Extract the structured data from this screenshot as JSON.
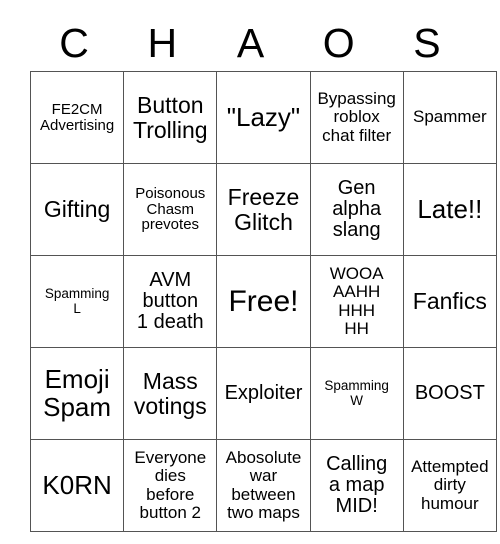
{
  "card": {
    "title_letters": [
      "C",
      "H",
      "A",
      "O",
      "S"
    ],
    "rows": [
      [
        {
          "text": "FE2CM\nAdvertising",
          "size": "fs-xxs"
        },
        {
          "text": "Button\nTrolling",
          "size": "fs-md"
        },
        {
          "text": "\"Lazy\"",
          "size": "fs-lg"
        },
        {
          "text": "Bypassing\nroblox\nchat filter",
          "size": "fs-xs"
        },
        {
          "text": "Spammer",
          "size": "fs-xs"
        }
      ],
      [
        {
          "text": "Gifting",
          "size": "fs-md"
        },
        {
          "text": "Poisonous\nChasm\nprevotes",
          "size": "fs-xxs"
        },
        {
          "text": "Freeze\nGlitch",
          "size": "fs-md"
        },
        {
          "text": "Gen\nalpha\nslang",
          "size": "fs-sm"
        },
        {
          "text": "Late!!",
          "size": "fs-lg"
        }
      ],
      [
        {
          "text": "Spamming\nL",
          "size": "fs-tiny"
        },
        {
          "text": "AVM\nbutton\n1 death",
          "size": "fs-sm"
        },
        {
          "text": "Free!",
          "size": "fs-xl"
        },
        {
          "text": "WOOA\nAAHH\nHHH\nHH",
          "size": "fs-xs"
        },
        {
          "text": "Fanfics",
          "size": "fs-md"
        }
      ],
      [
        {
          "text": "Emoji\nSpam",
          "size": "fs-lg"
        },
        {
          "text": "Mass\nvotings",
          "size": "fs-md"
        },
        {
          "text": "Exploiter",
          "size": "fs-sm"
        },
        {
          "text": "Spamming\nW",
          "size": "fs-tiny"
        },
        {
          "text": "BOOST",
          "size": "fs-sm"
        }
      ],
      [
        {
          "text": "K0RN",
          "size": "fs-lg"
        },
        {
          "text": "Everyone\ndies\nbefore\nbutton 2",
          "size": "fs-xs"
        },
        {
          "text": "Abosolute\nwar\nbetween\ntwo maps",
          "size": "fs-xs"
        },
        {
          "text": "Calling\na map\nMID!",
          "size": "fs-sm"
        },
        {
          "text": "Attempted\ndirty\nhumour",
          "size": "fs-xs"
        }
      ]
    ]
  },
  "colors": {
    "background": "#ffffff",
    "text": "#000000",
    "grid_line": "#545454"
  }
}
